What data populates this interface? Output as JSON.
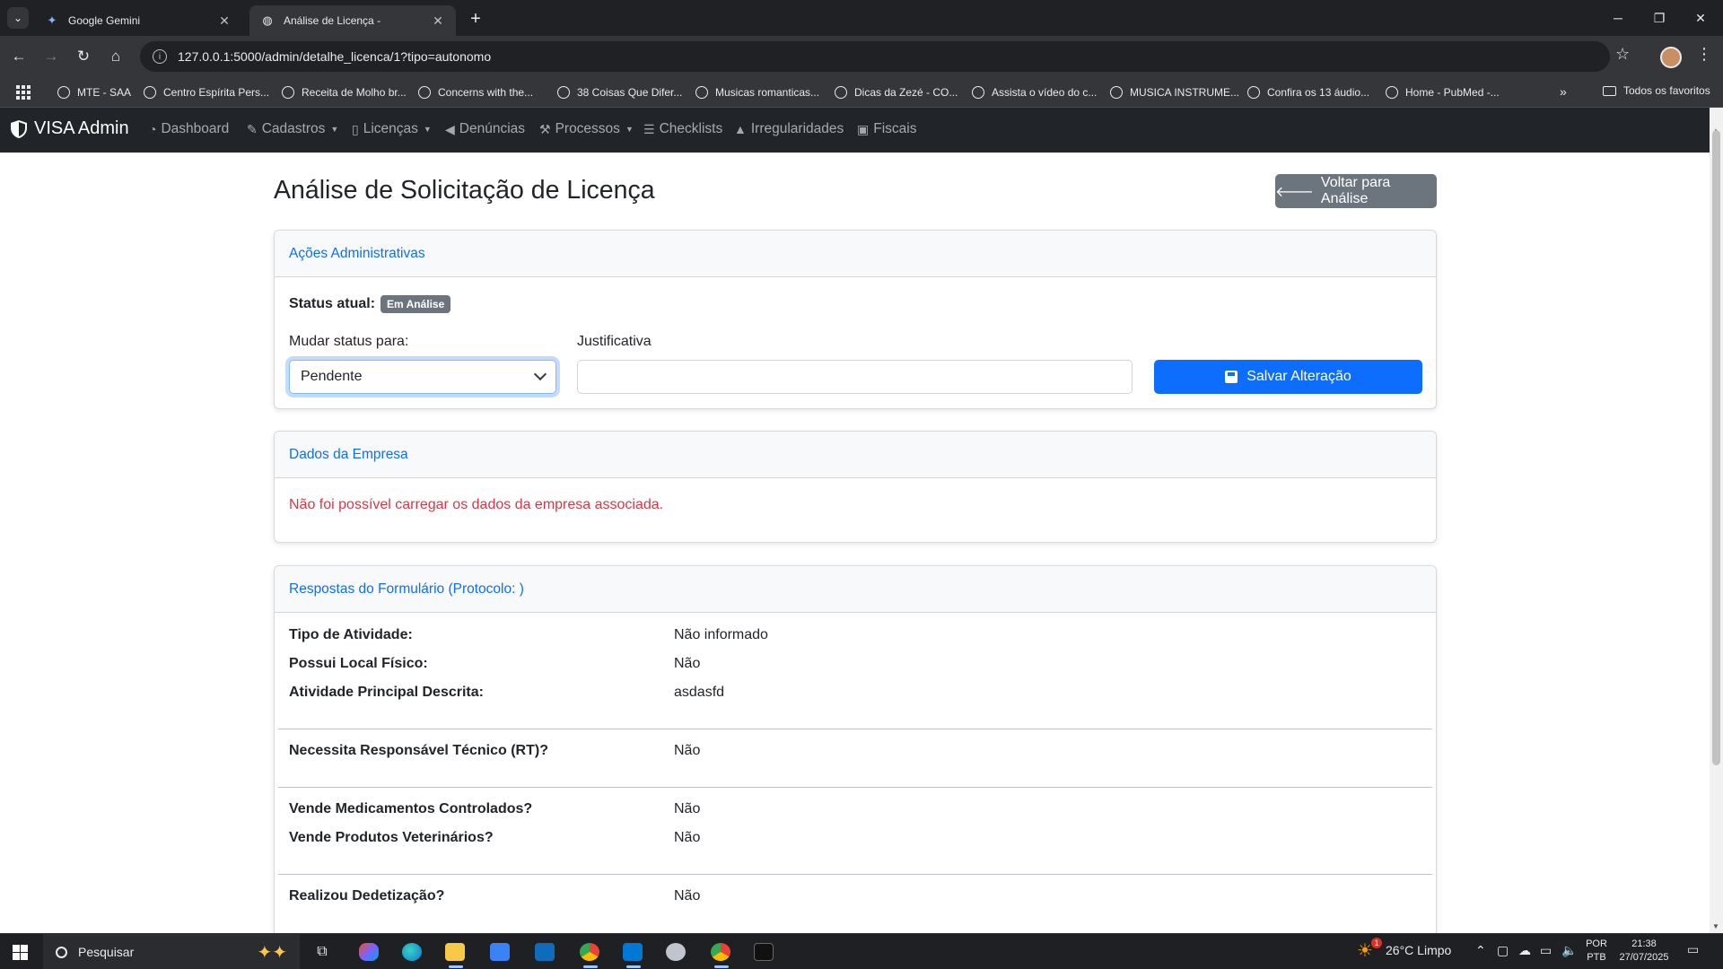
{
  "browser": {
    "tabs": [
      {
        "title": "Google Gemini",
        "active": false
      },
      {
        "title": "Análise de Licença -",
        "active": true
      }
    ],
    "url": "127.0.0.1:5000/admin/detalhe_licenca/1?tipo=autonomo",
    "bookmarks": [
      "MTE - SAA",
      "Centro Espírita Pers...",
      "Receita de Molho br...",
      "Concerns with the...",
      "38 Coisas Que Difer...",
      "Musicas romanticas...",
      "Dicas da Zezé - CO...",
      "Assista o vídeo do c...",
      "MUSICA INSTRUME...",
      "Confira os 13 áudio...",
      "Home - PubMed -..."
    ],
    "bookmarks_folder": "Todos os favoritos"
  },
  "nav": {
    "brand": "VISA Admin",
    "items": [
      {
        "label": "Dashboard",
        "icon": "gauge-icon",
        "dropdown": false
      },
      {
        "label": "Cadastros",
        "icon": "edit-icon",
        "dropdown": true
      },
      {
        "label": "Licenças",
        "icon": "file-icon",
        "dropdown": true
      },
      {
        "label": "Denúncias",
        "icon": "megaphone-icon",
        "dropdown": false
      },
      {
        "label": "Processos",
        "icon": "wrench-icon",
        "dropdown": true
      },
      {
        "label": "Checklists",
        "icon": "list-check-icon",
        "dropdown": false
      },
      {
        "label": "Irregularidades",
        "icon": "warning-icon",
        "dropdown": false
      },
      {
        "label": "Fiscais",
        "icon": "id-badge-icon",
        "dropdown": false
      }
    ]
  },
  "page": {
    "title": "Análise de Solicitação de Licença",
    "back_button": "Voltar para Análise"
  },
  "actions_card": {
    "header": "Ações Administrativas",
    "status_label": "Status atual:",
    "status_badge": "Em Análise",
    "change_label": "Mudar status para:",
    "selected_status": "Pendente",
    "justification_label": "Justificativa",
    "justification_value": "",
    "save_button": "Salvar Alteração"
  },
  "company_card": {
    "header": "Dados da Empresa",
    "error": "Não foi possível carregar os dados da empresa associada."
  },
  "form_card": {
    "header": "Respostas do Formulário (Protocolo: )",
    "groups": [
      [
        {
          "q": "Tipo de Atividade:",
          "a": "Não informado"
        },
        {
          "q": "Possui Local Físico:",
          "a": "Não"
        },
        {
          "q": "Atividade Principal Descrita:",
          "a": "asdasfd"
        }
      ],
      [
        {
          "q": "Necessita Responsável Técnico (RT)?",
          "a": "Não"
        }
      ],
      [
        {
          "q": "Vende Medicamentos Controlados?",
          "a": "Não"
        },
        {
          "q": "Vende Produtos Veterinários?",
          "a": "Não"
        }
      ],
      [
        {
          "q": "Realizou Dedetização?",
          "a": "Não"
        }
      ]
    ]
  },
  "taskbar": {
    "search_placeholder": "Pesquisar",
    "weather": "26°C  Limpo",
    "weather_alert": "1",
    "lang_top": "POR",
    "lang_bottom": "PTB",
    "time": "21:38",
    "date": "27/07/2025"
  }
}
